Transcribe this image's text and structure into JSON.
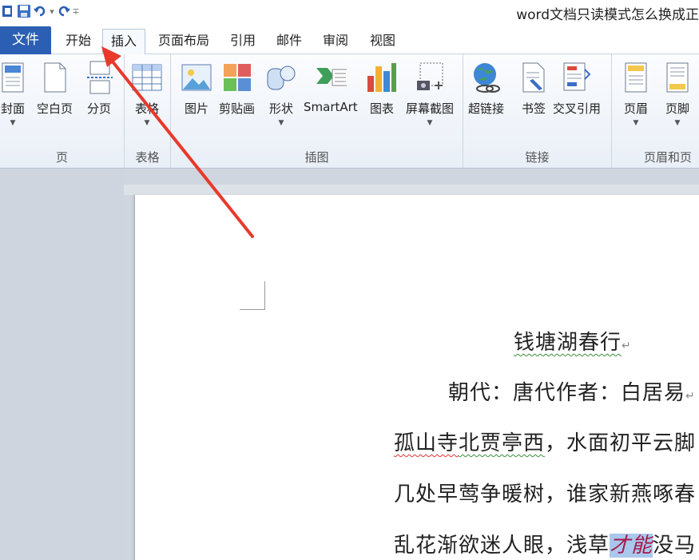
{
  "window": {
    "title": "word文档只读模式怎么换成正"
  },
  "tabs": {
    "file": "文件",
    "home": "开始",
    "insert": "插入",
    "layout": "页面布局",
    "references": "引用",
    "mailings": "邮件",
    "review": "审阅",
    "view": "视图"
  },
  "ribbon": {
    "pages": {
      "label": "页",
      "cover": "封面",
      "blank": "空白页",
      "break": "分页"
    },
    "tables": {
      "label": "表格",
      "table": "表格"
    },
    "illustrations": {
      "label": "插图",
      "picture": "图片",
      "clipart": "剪贴画",
      "shapes": "形状",
      "smartart": "SmartArt",
      "chart": "图表",
      "screenshot": "屏幕截图"
    },
    "links": {
      "label": "链接",
      "hyperlink": "超链接",
      "bookmark": "书签",
      "crossref": "交叉引用"
    },
    "header_footer": {
      "label": "页眉和页",
      "header": "页眉",
      "footer": "页脚"
    }
  },
  "document": {
    "title": "钱塘湖春行",
    "author_line": "朝代：唐代作者：白居易",
    "line1_a": "孤山寺",
    "line1_b": "北贾亭西",
    "line1_c": "，水面初平云脚",
    "line2": "几处早莺争暖树，谁家新燕啄春",
    "line3_a": "乱花渐欲迷人眼，浅草",
    "line3_sel": "才能",
    "line3_b": "没马",
    "para_mark": "↵"
  },
  "colors": {
    "file_tab": "#2b5fb3",
    "arrow": "#e8392b",
    "selection": "#a9c8ec"
  }
}
